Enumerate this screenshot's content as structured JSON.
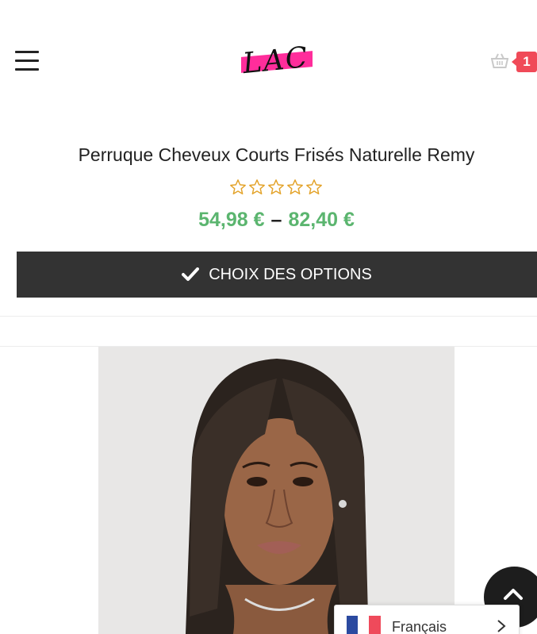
{
  "header": {
    "logo_text": "LAC",
    "cart_count": "1",
    "icons": {
      "menu": "hamburger-menu-icon",
      "cart": "shopping-basket-icon"
    }
  },
  "product": {
    "title": "Perruque Cheveux Courts Frisés Naturelle Remy",
    "rating_stars_filled": 0,
    "rating_stars_total": 5,
    "price_min": "54,98 €",
    "price_sep": "–",
    "price_max": "82,40 €",
    "options_button_label": "CHOIX DES OPTIONS",
    "image_subject": "woman-with-straight-bob-wig"
  },
  "language_switcher": {
    "selected": "Français",
    "icons": {
      "flag": "france-flag-icon",
      "chevron": "chevron-right-icon"
    }
  },
  "colors": {
    "price_green": "#5bb56f",
    "button_dark": "#333333",
    "badge_red": "#f04a58",
    "logo_pink": "#ff2d9b",
    "star_gold": "#e3a32a"
  }
}
